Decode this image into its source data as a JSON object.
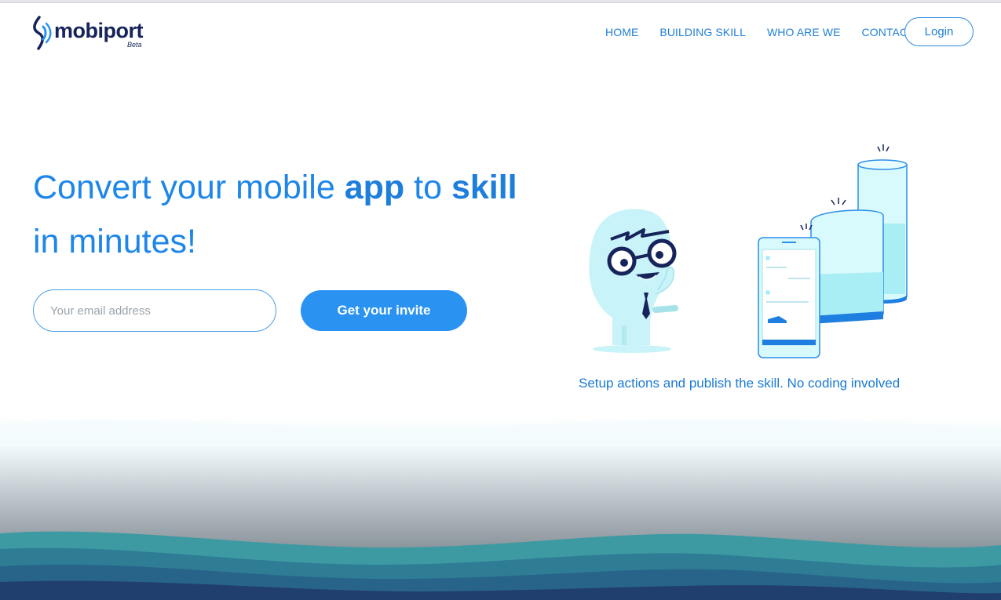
{
  "brand": {
    "name": "mobiport",
    "tag": "Beta",
    "logo_icon": "signal-wave-icon"
  },
  "nav": {
    "items": [
      {
        "label": "HOME"
      },
      {
        "label": "BUILDING SKILL"
      },
      {
        "label": "WHO ARE WE"
      },
      {
        "label": "CONTACT"
      }
    ],
    "login_label": "Login"
  },
  "hero": {
    "title_part1": "Convert your mobile ",
    "title_bold1": "app",
    "title_part2": " to ",
    "title_bold2": "skill",
    "title_line2": "in minutes!",
    "email_placeholder": "Your email address",
    "cta_label": "Get your invite"
  },
  "illustration": {
    "caption": "Setup actions and publish the skill. No coding involved",
    "icons": [
      "mascot-character-illustration",
      "smartphone-chat-illustration",
      "smart-speaker-short-illustration",
      "smart-speaker-tall-illustration"
    ]
  },
  "colors": {
    "accent": "#2a93f1",
    "brand_navy": "#16245b",
    "link": "#1e7fd6",
    "illustration_fill": "#c8f3f8",
    "illustration_stroke": "#2a8ee8"
  }
}
